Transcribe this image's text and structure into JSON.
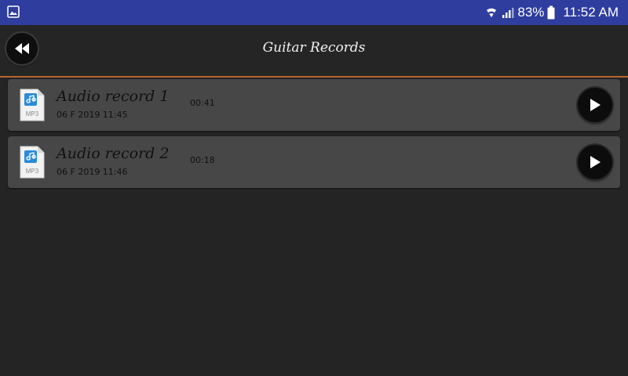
{
  "status_bar": {
    "battery": "83%",
    "time": "11:52 AM",
    "icons": [
      "photo-icon",
      "wifi-icon",
      "signal-icon",
      "battery-icon"
    ]
  },
  "app_bar": {
    "title": "Guitar Records",
    "back_icon": "rewind-back-icon"
  },
  "colors": {
    "status_bar": "#2f3d9e",
    "background": "#242424",
    "row": "#474747",
    "divider": "#b4682e"
  },
  "records": [
    {
      "name": "Audio record 1",
      "date": "06 F 2019 11:45",
      "duration": "00:41",
      "file_type": "MP3"
    },
    {
      "name": "Audio record 2",
      "date": "06 F 2019 11:46",
      "duration": "00:18",
      "file_type": "MP3"
    }
  ]
}
